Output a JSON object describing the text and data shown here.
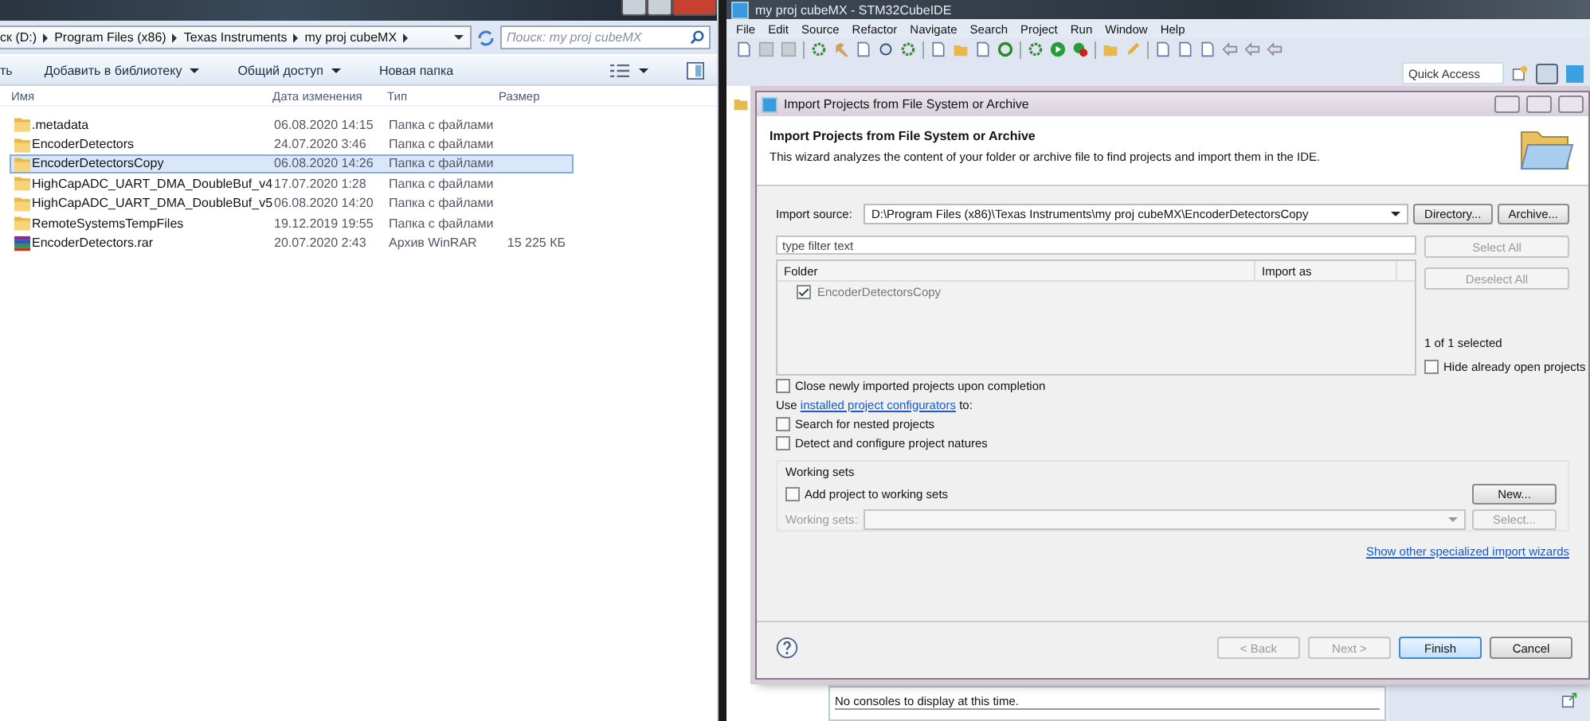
{
  "explorer": {
    "breadcrumb": [
      "ск (D:)",
      "Program Files (x86)",
      "Texas Instruments",
      "my proj cubeMX"
    ],
    "search": {
      "placeholder": "Поиск: my proj cubeMX"
    },
    "toolbar": [
      {
        "label": "ть",
        "dropdown": false
      },
      {
        "label": "Добавить в библиотеку",
        "dropdown": true
      },
      {
        "label": "Общий доступ",
        "dropdown": true
      },
      {
        "label": "Новая папка",
        "dropdown": false
      }
    ],
    "columns": [
      "Имя",
      "Дата изменения",
      "Тип",
      "Размер"
    ],
    "rows": [
      {
        "kind": "folder",
        "name": ".metadata",
        "date": "06.08.2020 14:15",
        "type": "Папка с файлами",
        "selected": false
      },
      {
        "kind": "folder",
        "name": "EncoderDetectors",
        "date": "24.07.2020 3:46",
        "type": "Папка с файлами",
        "selected": false
      },
      {
        "kind": "folder",
        "name": "EncoderDetectorsCopy",
        "date": "06.08.2020 14:26",
        "type": "Папка с файлами",
        "selected": true
      },
      {
        "kind": "folder",
        "name": "HighCapADC_UART_DMA_DoubleBuf_v4",
        "date": "17.07.2020 1:28",
        "type": "Папка с файлами",
        "selected": false
      },
      {
        "kind": "folder",
        "name": "HighCapADC_UART_DMA_DoubleBuf_v5",
        "date": "06.08.2020 14:20",
        "type": "Папка с файлами",
        "selected": false
      },
      {
        "kind": "folder",
        "name": "RemoteSystemsTempFiles",
        "date": "19.12.2019 19:55",
        "type": "Папка с файлами",
        "selected": false
      },
      {
        "kind": "archive",
        "name": "EncoderDetectors.rar",
        "date": "20.07.2020 2:43",
        "type": "Архив WinRAR",
        "size": "15 225 КБ",
        "selected": false
      }
    ]
  },
  "ide": {
    "title": "my proj cubeMX - STM32CubeIDE",
    "menu": [
      "File",
      "Edit",
      "Source",
      "Refactor",
      "Navigate",
      "Search",
      "Project",
      "Run",
      "Window",
      "Help"
    ],
    "quick_access": {
      "placeholder": "Quick Access"
    },
    "console": "No consoles to display at this time."
  },
  "dialog": {
    "title": "Import Projects from File System or Archive",
    "heading": "Import Projects from File System or Archive",
    "description": "This wizard analyzes the content of your folder or archive file to find projects and import them in the IDE.",
    "source_label": "Import source:",
    "source_value": "D:\\Program Files (x86)\\Texas Instruments\\my proj cubeMX\\EncoderDetectorsCopy",
    "source_buttons": [
      "Directory...",
      "Archive..."
    ],
    "filter": {
      "placeholder": "type filter text"
    },
    "columns": [
      "Folder",
      "Import as"
    ],
    "projects": [
      {
        "name": "EncoderDetectorsCopy",
        "checked": true
      }
    ],
    "side_buttons": [
      {
        "label": "Select All",
        "disabled": true
      },
      {
        "label": "Deselect All",
        "disabled": true
      }
    ],
    "selection_count": "1 of 1 selected",
    "hide_open": {
      "label": "Hide already open projects",
      "checked": false
    },
    "close_new": {
      "label": "Close newly imported projects upon completion",
      "checked": false
    },
    "configurators": {
      "before": "Use ",
      "link": "installed project configurators",
      "after": " to:"
    },
    "options": [
      {
        "label": "Search for nested projects",
        "checked": false
      },
      {
        "label": "Detect and configure project natures",
        "checked": false
      }
    ],
    "working_sets": {
      "legend": "Working sets",
      "add": {
        "label": "Add project to working sets",
        "checked": false
      },
      "new_button": "New...",
      "sets_label": "Working sets:",
      "select_button": "Select...",
      "disabled": true
    },
    "wizards_link": "Show other specialized import wizards",
    "footer_buttons": [
      {
        "label": "< Back",
        "disabled": true,
        "default": false
      },
      {
        "label": "Next >",
        "disabled": true,
        "default": false
      },
      {
        "label": "Finish",
        "disabled": false,
        "default": true
      },
      {
        "label": "Cancel",
        "disabled": false,
        "default": false
      }
    ]
  }
}
